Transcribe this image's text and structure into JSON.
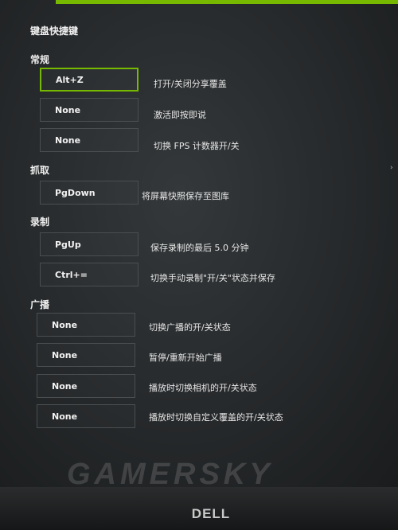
{
  "panel": {
    "title": "键盘快捷键"
  },
  "sections": {
    "general": "常规",
    "capture": "抓取",
    "record": "录制",
    "broadcast": "广播"
  },
  "shortcuts": [
    {
      "key": "Alt+Z",
      "desc": "打开/关闭分享覆盖"
    },
    {
      "key": "None",
      "desc": "激活即按即说"
    },
    {
      "key": "None",
      "desc": "切换 FPS 计数器开/关"
    },
    {
      "key": "PgDown",
      "desc": "将屏幕快照保存至图库"
    },
    {
      "key": "PgUp",
      "desc": "保存录制的最后 5.0 分钟"
    },
    {
      "key": "Ctrl+=",
      "desc": "切换手动录制\"开/关\"状态并保存"
    },
    {
      "key": "None",
      "desc": "切换广播的开/关状态"
    },
    {
      "key": "None",
      "desc": "暂停/重新开始广播"
    },
    {
      "key": "None",
      "desc": "播放时切换相机的开/关状态"
    },
    {
      "key": "None",
      "desc": "播放时切换自定义覆盖的开/关状态"
    }
  ],
  "bezel": {
    "brand": "DELL"
  },
  "watermark": "GAMERSKY",
  "colors": {
    "accent": "#76b900",
    "background": "#2a2d2f"
  }
}
